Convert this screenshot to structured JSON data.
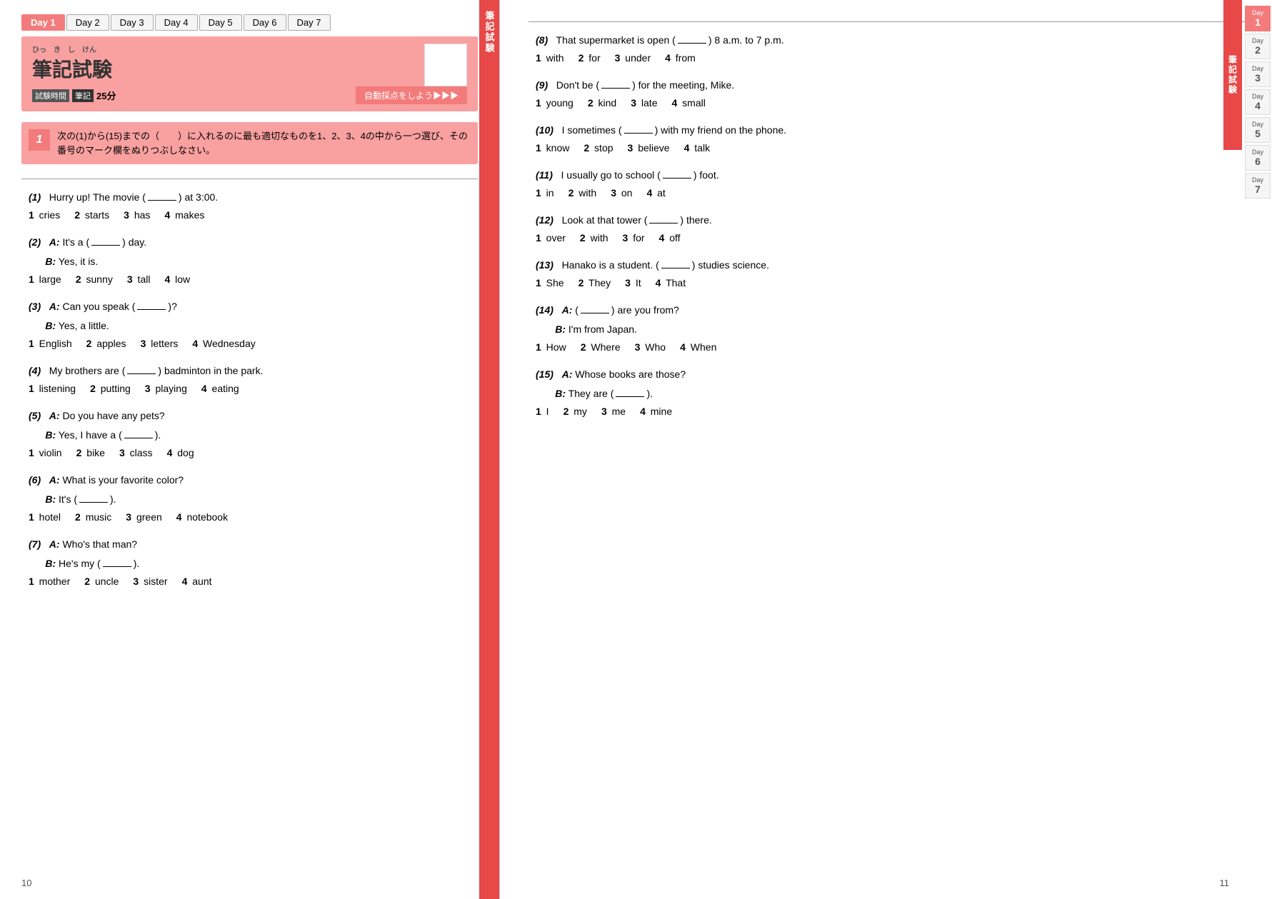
{
  "tabs": [
    {
      "label": "Day 1",
      "active": true
    },
    {
      "label": "Day 2",
      "active": false
    },
    {
      "label": "Day 3",
      "active": false
    },
    {
      "label": "Day 4",
      "active": false
    },
    {
      "label": "Day 5",
      "active": false
    },
    {
      "label": "Day 6",
      "active": false
    },
    {
      "label": "Day 7",
      "active": false
    }
  ],
  "header": {
    "title": "筆記試験",
    "title_reading": "ひっきしけん",
    "time_label": "試験時間",
    "pencil_label": "筆記",
    "time_value": "25分",
    "auto_score": "自動採点をしよう▶▶▶"
  },
  "instruction": {
    "number": "1",
    "text": "次の(1)から(15)までの（　　）に入れるのに最も適切なものを1、2、3、4の中から一つ選び、その番号のマーク欄をぬりつぶしなさい。"
  },
  "left_questions": [
    {
      "num": "(1)",
      "lines": [
        "Hurry up!  The movie (        ) at 3:00."
      ],
      "choices": [
        {
          "n": "1",
          "text": "cries"
        },
        {
          "n": "2",
          "text": "starts"
        },
        {
          "n": "3",
          "text": "has"
        },
        {
          "n": "4",
          "text": "makes"
        }
      ]
    },
    {
      "num": "(2)",
      "lines": [
        "A:  It's a (        ) day.",
        "B:  Yes, it is."
      ],
      "choices": [
        {
          "n": "1",
          "text": "large"
        },
        {
          "n": "2",
          "text": "sunny"
        },
        {
          "n": "3",
          "text": "tall"
        },
        {
          "n": "4",
          "text": "low"
        }
      ]
    },
    {
      "num": "(3)",
      "lines": [
        "A:  Can you speak (        )?",
        "B:  Yes, a little."
      ],
      "choices": [
        {
          "n": "1",
          "text": "English"
        },
        {
          "n": "2",
          "text": "apples"
        },
        {
          "n": "3",
          "text": "letters"
        },
        {
          "n": "4",
          "text": "Wednesday"
        }
      ]
    },
    {
      "num": "(4)",
      "lines": [
        "My brothers are (        ) badminton in the park."
      ],
      "choices": [
        {
          "n": "1",
          "text": "listening"
        },
        {
          "n": "2",
          "text": "putting"
        },
        {
          "n": "3",
          "text": "playing"
        },
        {
          "n": "4",
          "text": "eating"
        }
      ]
    },
    {
      "num": "(5)",
      "lines": [
        "A:  Do you have any pets?",
        "B:  Yes, I have a (        )."
      ],
      "choices": [
        {
          "n": "1",
          "text": "violin"
        },
        {
          "n": "2",
          "text": "bike"
        },
        {
          "n": "3",
          "text": "class"
        },
        {
          "n": "4",
          "text": "dog"
        }
      ]
    },
    {
      "num": "(6)",
      "lines": [
        "A:  What is your favorite color?",
        "B:  It's (        )."
      ],
      "choices": [
        {
          "n": "1",
          "text": "hotel"
        },
        {
          "n": "2",
          "text": "music"
        },
        {
          "n": "3",
          "text": "green"
        },
        {
          "n": "4",
          "text": "notebook"
        }
      ]
    },
    {
      "num": "(7)",
      "lines": [
        "A:  Who's that man?",
        "B:  He's my (        )."
      ],
      "choices": [
        {
          "n": "1",
          "text": "mother"
        },
        {
          "n": "2",
          "text": "uncle"
        },
        {
          "n": "3",
          "text": "sister"
        },
        {
          "n": "4",
          "text": "aunt"
        }
      ]
    }
  ],
  "right_questions": [
    {
      "num": "(8)",
      "lines": [
        "That supermarket is open (        ) 8 a.m. to 7 p.m."
      ],
      "choices": [
        {
          "n": "1",
          "text": "with"
        },
        {
          "n": "2",
          "text": "for"
        },
        {
          "n": "3",
          "text": "under"
        },
        {
          "n": "4",
          "text": "from"
        }
      ]
    },
    {
      "num": "(9)",
      "lines": [
        "Don't be (        ) for the meeting, Mike."
      ],
      "choices": [
        {
          "n": "1",
          "text": "young"
        },
        {
          "n": "2",
          "text": "kind"
        },
        {
          "n": "3",
          "text": "late"
        },
        {
          "n": "4",
          "text": "small"
        }
      ]
    },
    {
      "num": "(10)",
      "lines": [
        "I sometimes (        ) with my friend on the phone."
      ],
      "choices": [
        {
          "n": "1",
          "text": "know"
        },
        {
          "n": "2",
          "text": "stop"
        },
        {
          "n": "3",
          "text": "believe"
        },
        {
          "n": "4",
          "text": "talk"
        }
      ]
    },
    {
      "num": "(11)",
      "lines": [
        "I usually go to school (        ) foot."
      ],
      "choices": [
        {
          "n": "1",
          "text": "in"
        },
        {
          "n": "2",
          "text": "with"
        },
        {
          "n": "3",
          "text": "on"
        },
        {
          "n": "4",
          "text": "at"
        }
      ]
    },
    {
      "num": "(12)",
      "lines": [
        "Look at that tower (        ) there."
      ],
      "choices": [
        {
          "n": "1",
          "text": "over"
        },
        {
          "n": "2",
          "text": "with"
        },
        {
          "n": "3",
          "text": "for"
        },
        {
          "n": "4",
          "text": "off"
        }
      ]
    },
    {
      "num": "(13)",
      "lines": [
        "Hanako is a student. (        ) studies science."
      ],
      "choices": [
        {
          "n": "1",
          "text": "She"
        },
        {
          "n": "2",
          "text": "They"
        },
        {
          "n": "3",
          "text": "It"
        },
        {
          "n": "4",
          "text": "That"
        }
      ]
    },
    {
      "num": "(14)",
      "lines": [
        "A:  (        ) are you from?",
        "B:  I'm from Japan."
      ],
      "choices": [
        {
          "n": "1",
          "text": "How"
        },
        {
          "n": "2",
          "text": "Where"
        },
        {
          "n": "3",
          "text": "Who"
        },
        {
          "n": "4",
          "text": "When"
        }
      ]
    },
    {
      "num": "(15)",
      "lines": [
        "A:  Whose books are those?",
        "B:  They are (        )."
      ],
      "choices": [
        {
          "n": "1",
          "text": "I"
        },
        {
          "n": "2",
          "text": "my"
        },
        {
          "n": "3",
          "text": "me"
        },
        {
          "n": "4",
          "text": "mine"
        }
      ]
    }
  ],
  "vertical_label": "筆記試験",
  "day_nums": [
    {
      "day": "Day",
      "num": "1",
      "active": true
    },
    {
      "day": "Day",
      "num": "2",
      "active": false
    },
    {
      "day": "Day",
      "num": "3",
      "active": false
    },
    {
      "day": "Day",
      "num": "4",
      "active": false
    },
    {
      "day": "Day",
      "num": "5",
      "active": false
    },
    {
      "day": "Day",
      "num": "6",
      "active": false
    },
    {
      "day": "Day",
      "num": "7",
      "active": false
    }
  ],
  "page_left": "10",
  "page_right": "11"
}
